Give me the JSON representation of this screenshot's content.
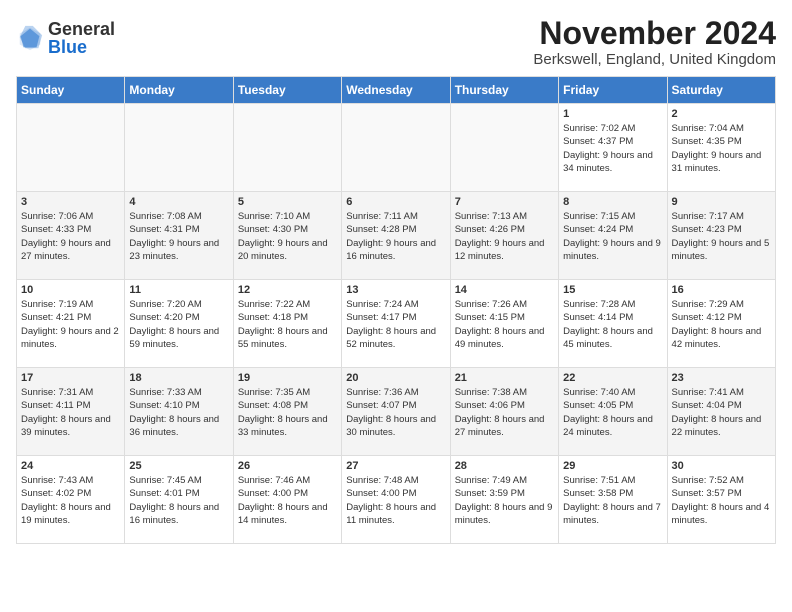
{
  "header": {
    "logo_general": "General",
    "logo_blue": "Blue",
    "month_title": "November 2024",
    "location": "Berkswell, England, United Kingdom"
  },
  "weekdays": [
    "Sunday",
    "Monday",
    "Tuesday",
    "Wednesday",
    "Thursday",
    "Friday",
    "Saturday"
  ],
  "weeks": [
    [
      {
        "day": "",
        "info": ""
      },
      {
        "day": "",
        "info": ""
      },
      {
        "day": "",
        "info": ""
      },
      {
        "day": "",
        "info": ""
      },
      {
        "day": "",
        "info": ""
      },
      {
        "day": "1",
        "info": "Sunrise: 7:02 AM\nSunset: 4:37 PM\nDaylight: 9 hours\nand 34 minutes."
      },
      {
        "day": "2",
        "info": "Sunrise: 7:04 AM\nSunset: 4:35 PM\nDaylight: 9 hours\nand 31 minutes."
      }
    ],
    [
      {
        "day": "3",
        "info": "Sunrise: 7:06 AM\nSunset: 4:33 PM\nDaylight: 9 hours\nand 27 minutes."
      },
      {
        "day": "4",
        "info": "Sunrise: 7:08 AM\nSunset: 4:31 PM\nDaylight: 9 hours\nand 23 minutes."
      },
      {
        "day": "5",
        "info": "Sunrise: 7:10 AM\nSunset: 4:30 PM\nDaylight: 9 hours\nand 20 minutes."
      },
      {
        "day": "6",
        "info": "Sunrise: 7:11 AM\nSunset: 4:28 PM\nDaylight: 9 hours\nand 16 minutes."
      },
      {
        "day": "7",
        "info": "Sunrise: 7:13 AM\nSunset: 4:26 PM\nDaylight: 9 hours\nand 12 minutes."
      },
      {
        "day": "8",
        "info": "Sunrise: 7:15 AM\nSunset: 4:24 PM\nDaylight: 9 hours\nand 9 minutes."
      },
      {
        "day": "9",
        "info": "Sunrise: 7:17 AM\nSunset: 4:23 PM\nDaylight: 9 hours\nand 5 minutes."
      }
    ],
    [
      {
        "day": "10",
        "info": "Sunrise: 7:19 AM\nSunset: 4:21 PM\nDaylight: 9 hours\nand 2 minutes."
      },
      {
        "day": "11",
        "info": "Sunrise: 7:20 AM\nSunset: 4:20 PM\nDaylight: 8 hours\nand 59 minutes."
      },
      {
        "day": "12",
        "info": "Sunrise: 7:22 AM\nSunset: 4:18 PM\nDaylight: 8 hours\nand 55 minutes."
      },
      {
        "day": "13",
        "info": "Sunrise: 7:24 AM\nSunset: 4:17 PM\nDaylight: 8 hours\nand 52 minutes."
      },
      {
        "day": "14",
        "info": "Sunrise: 7:26 AM\nSunset: 4:15 PM\nDaylight: 8 hours\nand 49 minutes."
      },
      {
        "day": "15",
        "info": "Sunrise: 7:28 AM\nSunset: 4:14 PM\nDaylight: 8 hours\nand 45 minutes."
      },
      {
        "day": "16",
        "info": "Sunrise: 7:29 AM\nSunset: 4:12 PM\nDaylight: 8 hours\nand 42 minutes."
      }
    ],
    [
      {
        "day": "17",
        "info": "Sunrise: 7:31 AM\nSunset: 4:11 PM\nDaylight: 8 hours\nand 39 minutes."
      },
      {
        "day": "18",
        "info": "Sunrise: 7:33 AM\nSunset: 4:10 PM\nDaylight: 8 hours\nand 36 minutes."
      },
      {
        "day": "19",
        "info": "Sunrise: 7:35 AM\nSunset: 4:08 PM\nDaylight: 8 hours\nand 33 minutes."
      },
      {
        "day": "20",
        "info": "Sunrise: 7:36 AM\nSunset: 4:07 PM\nDaylight: 8 hours\nand 30 minutes."
      },
      {
        "day": "21",
        "info": "Sunrise: 7:38 AM\nSunset: 4:06 PM\nDaylight: 8 hours\nand 27 minutes."
      },
      {
        "day": "22",
        "info": "Sunrise: 7:40 AM\nSunset: 4:05 PM\nDaylight: 8 hours\nand 24 minutes."
      },
      {
        "day": "23",
        "info": "Sunrise: 7:41 AM\nSunset: 4:04 PM\nDaylight: 8 hours\nand 22 minutes."
      }
    ],
    [
      {
        "day": "24",
        "info": "Sunrise: 7:43 AM\nSunset: 4:02 PM\nDaylight: 8 hours\nand 19 minutes."
      },
      {
        "day": "25",
        "info": "Sunrise: 7:45 AM\nSunset: 4:01 PM\nDaylight: 8 hours\nand 16 minutes."
      },
      {
        "day": "26",
        "info": "Sunrise: 7:46 AM\nSunset: 4:00 PM\nDaylight: 8 hours\nand 14 minutes."
      },
      {
        "day": "27",
        "info": "Sunrise: 7:48 AM\nSunset: 4:00 PM\nDaylight: 8 hours\nand 11 minutes."
      },
      {
        "day": "28",
        "info": "Sunrise: 7:49 AM\nSunset: 3:59 PM\nDaylight: 8 hours\nand 9 minutes."
      },
      {
        "day": "29",
        "info": "Sunrise: 7:51 AM\nSunset: 3:58 PM\nDaylight: 8 hours\nand 7 minutes."
      },
      {
        "day": "30",
        "info": "Sunrise: 7:52 AM\nSunset: 3:57 PM\nDaylight: 8 hours\nand 4 minutes."
      }
    ]
  ]
}
